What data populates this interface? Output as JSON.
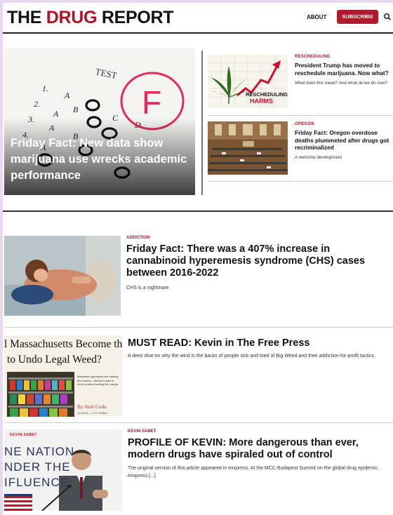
{
  "header": {
    "logo_part1": "THE ",
    "logo_part2": "DRUG",
    "logo_part3": " REPORT",
    "nav_about": "ABOUT",
    "subscribe_label": "SUBSCRIBE"
  },
  "hero": {
    "title": "Friday Fact: New data show marijuana use wrecks academic performance",
    "image": {
      "test_word": "TEST",
      "letters": [
        "1.",
        "A",
        "B",
        "2.",
        "A",
        "3.",
        "A",
        "B",
        "4.",
        "A",
        "C",
        "D",
        "F"
      ]
    }
  },
  "side_stories": [
    {
      "tag": "RESCHEDULING",
      "title": "President Trump has moved to reschedule marijuana. Now what?",
      "sub": "What does this mean? And what do we do now?",
      "image_text_1": "RESCHEDULING",
      "image_text_2": "HARMS"
    },
    {
      "tag": "OREGON",
      "title": "Friday Fact: Oregon overdose deaths plummeted after drugs got recriminalized",
      "sub": "A welcome development"
    }
  ],
  "articles": [
    {
      "tag": "ADDICTION",
      "title": "Friday Fact: There was a 407% increase in cannabinoid hyperemesis syndrome (CHS) cases between 2016-2022",
      "sub": "CHS is a nightmare."
    },
    {
      "tag": "",
      "title": "MUST READ: Kevin in The Free Press",
      "sub": "A deeo dive on why the wind is the backs of people sick and tired of Big Weed and their addiction-for-profit tactics.",
      "image_headline_1": "l Massachusetts Become the",
      "image_headline_2": "to Undo Legal Weed?",
      "image_byline": "By Josh Code",
      "image_blurb": "Marijuana opponents are ranking the country—thanks in part to Kevin adviser leading the charge.",
      "image_date": "10.05.25 — U.S. Politics"
    },
    {
      "tag": "KEVIN SABET",
      "title": "PROFILE OF KEVIN: More dangerous than ever, modern drugs have spiraled out of control",
      "sub": "The original version of this article appeared in exxpress. At the MCC Budapest Summit on the global drug epidemic, exxpress [...]",
      "image_small": "KEVIN SABET",
      "image_lines": [
        "NE NATION",
        "NDER THE",
        "IFLUENCE"
      ]
    }
  ]
}
